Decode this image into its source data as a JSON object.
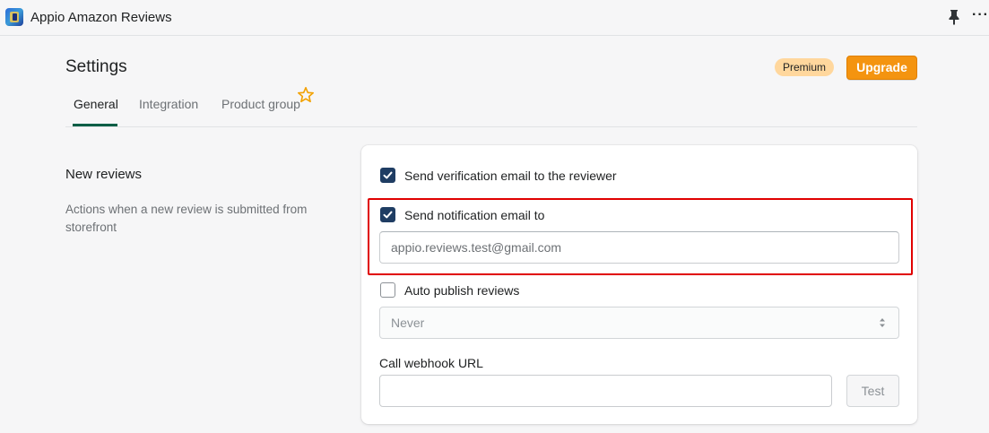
{
  "app": {
    "title": "Appio Amazon Reviews",
    "icon": "appio-app-icon",
    "pin_icon": "pin-icon",
    "more_icon": "more-horizontal-icon",
    "more_glyph": "···"
  },
  "header": {
    "title": "Settings",
    "premium_badge": "Premium",
    "upgrade_label": "Upgrade"
  },
  "tabs": [
    {
      "label": "General",
      "active": true
    },
    {
      "label": "Integration",
      "active": false
    },
    {
      "label": "Product group",
      "active": false,
      "icon": "star-outline-icon"
    }
  ],
  "section": {
    "title": "New reviews",
    "description": "Actions when a new review is submitted from storefront"
  },
  "form": {
    "verification": {
      "label": "Send verification email to the reviewer",
      "checked": true
    },
    "notification": {
      "label": "Send notification email to",
      "checked": true,
      "email_value": "appio.reviews.test@gmail.com"
    },
    "auto_publish": {
      "label": "Auto publish reviews",
      "checked": false,
      "select_value": "Never"
    },
    "webhook": {
      "label": "Call webhook URL",
      "value": "",
      "test_label": "Test"
    }
  },
  "colors": {
    "accent_orange": "#f49410",
    "premium_badge_bg": "#ffd79d",
    "checkbox_checked": "#1f3d63",
    "highlight_red": "#e00000",
    "tab_underline": "#005e46"
  }
}
